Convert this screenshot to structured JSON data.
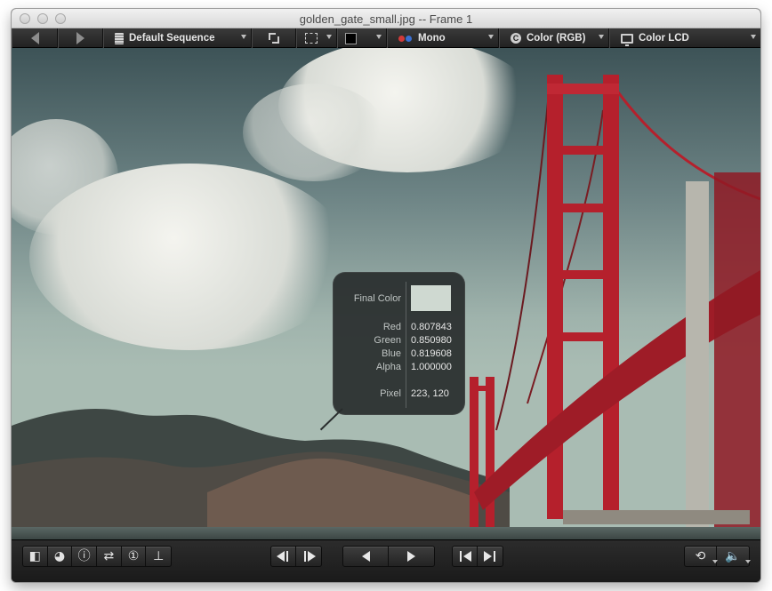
{
  "window": {
    "title": "golden_gate_small.jpg -- Frame 1"
  },
  "toolbar": {
    "sequence_label": "Default Sequence",
    "channel_label": "Mono",
    "color_label": "Color (RGB)",
    "display_label": "Color LCD",
    "rgb_icon_letter": "C"
  },
  "pixel_info": {
    "final_color_label": "Final Color",
    "final_color_hex": "#cfd9d1",
    "rows": [
      {
        "label": "Red",
        "value": "0.807843"
      },
      {
        "label": "Green",
        "value": "0.850980"
      },
      {
        "label": "Blue",
        "value": "0.819608"
      },
      {
        "label": "Alpha",
        "value": "1.000000"
      }
    ],
    "pixel_label": "Pixel",
    "pixel_value": "223, 120"
  },
  "colors": {
    "bridge_red": "#b5202c",
    "accent_red": "#d23a3a",
    "accent_blue": "#3a6fd2"
  },
  "icons": {
    "back": "arrow-left-icon",
    "forward": "arrow-right-icon",
    "sequence": "document-icon",
    "fit": "fit-to-window-icon",
    "crop": "crop-icon",
    "background": "color-swatch-icon",
    "channel": "channel-dots-icon",
    "color_mode": "color-mode-icon",
    "display": "display-icon"
  }
}
